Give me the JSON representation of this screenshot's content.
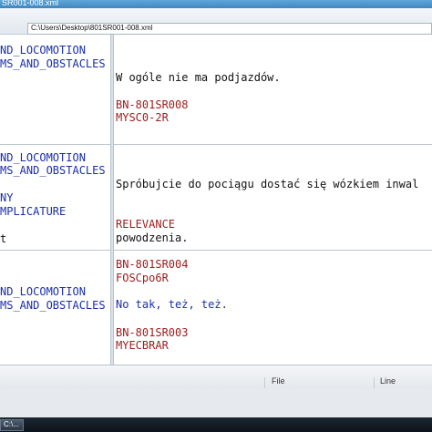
{
  "window": {
    "title": "SR001-008.xml"
  },
  "address": {
    "path": "C:\\Users\\Desktop\\801SR001-008.xml"
  },
  "left_lines": [
    "ND_LOCOMOTION",
    "MS_AND_OBSTACLES",
    "ND_LOCOMOTION",
    "MS_AND_OBSTACLES",
    "NY",
    "MPLICATURE",
    "t",
    "ND_LOCOMOTION",
    "MS_AND_OBSTACLES"
  ],
  "right_lines": [
    "W ogóle nie ma podjazdów.",
    "BN-801SR008",
    "MYSC0-2R",
    "Spróbujcie do pociągu dostać się wózkiem inwal",
    "RELEVANCE",
    "powodzenia.",
    "BN-801SR004",
    "FOSCpo6R",
    "No tak, też, też.",
    "BN-801SR003",
    "MYECBRAR"
  ],
  "status": {
    "col1": "File",
    "col2": "Line"
  },
  "taskbar": {
    "item": "C:\\..."
  }
}
